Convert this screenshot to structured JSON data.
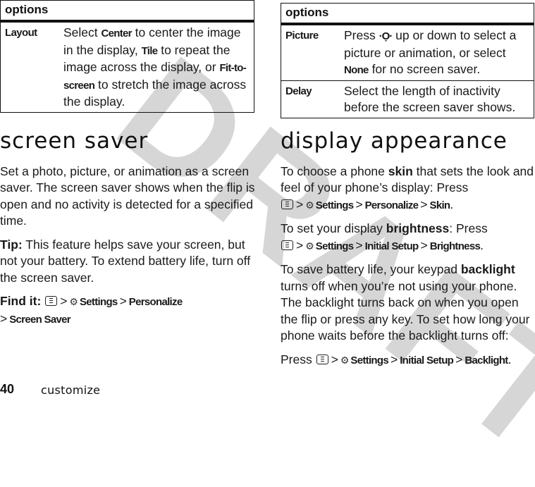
{
  "watermark": "DRAFT",
  "left_column": {
    "options_table": {
      "header": "options",
      "rows": [
        {
          "name": "Layout",
          "desc_parts": [
            "Select ",
            "Center",
            " to center the image in the display, ",
            "Tile",
            " to repeat the image across the display, or ",
            "Fit-to-screen",
            " to stretch the image across the display."
          ]
        }
      ]
    },
    "section_title": "screen saver",
    "intro": "Set a photo, picture, or animation as a screen saver. The screen saver shows when the flip is open and no activity is detected for a specified time.",
    "tip_label": "Tip:",
    "tip_text": " This feature helps save your screen, but not your battery. To extend battery life, turn off the screen saver.",
    "find_it": {
      "label": "Find it:",
      "path": [
        "Settings",
        "Personalize",
        "Screen Saver"
      ]
    }
  },
  "right_column": {
    "options_table": {
      "header": "options",
      "rows": [
        {
          "name": "Picture",
          "desc_parts": [
            "Press ",
            "navigation-key",
            " up or down to select a picture or animation, or select ",
            "None",
            " for no screen saver."
          ]
        },
        {
          "name": "Delay",
          "desc": "Select the length of inactivity before the screen saver shows."
        }
      ]
    },
    "section_title": "display appearance",
    "skin": {
      "before": "To choose a phone ",
      "term": "skin",
      "after": " that sets the look and feel of your phone’s display: Press",
      "path": [
        "Settings",
        "Personalize",
        "Skin"
      ]
    },
    "brightness": {
      "before": "To set your display ",
      "term": "brightness",
      "after": ": Press",
      "path": [
        "Settings",
        "Initial Setup",
        "Brightness"
      ]
    },
    "backlight": {
      "before": "To save battery life, your keypad ",
      "term": "backlight",
      "after": " turns off when you’re not using your phone. The backlight turns back on when you open the flip or press any key. To set how long your phone waits before the backlight turns off:",
      "press": "Press",
      "path": [
        "Settings",
        "Initial Setup",
        "Backlight"
      ]
    }
  },
  "footer": {
    "page_number": "40",
    "section": "customize"
  },
  "symbols": {
    "separator": ">",
    "period": ".",
    "settings_glyph": "⚙",
    "nav_glyph": "·Ọ·"
  }
}
